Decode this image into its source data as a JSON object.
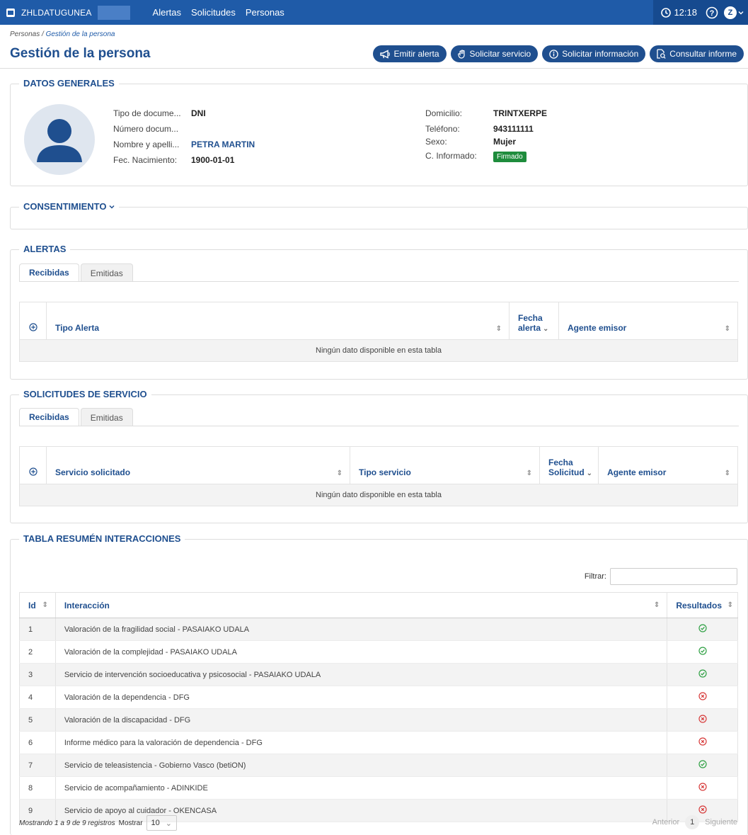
{
  "topbar": {
    "brand": "ZHLDATUGUNEA",
    "nav": [
      "Alertas",
      "Solicitudes",
      "Personas"
    ],
    "time": "12:18",
    "user_initial": "Z"
  },
  "breadcrumb": {
    "parent": "Personas",
    "separator": " / ",
    "current": "Gestión de la persona"
  },
  "page_title": "Gestión de la persona",
  "actions": {
    "emitir": "Emitir alerta",
    "solicitar_servicio": "Solicitar servicio",
    "solicitar_informacion": "Solicitar información",
    "consultar_informe": "Consultar informe"
  },
  "datos_generales": {
    "title": "DATOS GENERALES",
    "left": [
      {
        "label": "Tipo de docume...",
        "value": "DNI"
      },
      {
        "label": "Número docum...",
        "value": ""
      },
      {
        "label": "Nombre y apelli...",
        "value": "PETRA MARTIN"
      },
      {
        "label": "Fec. Nacimiento:",
        "value": "1900-01-01"
      }
    ],
    "right": [
      {
        "label": "Domicilio:",
        "value": "TRINTXERPE"
      },
      {
        "label": "Teléfono:",
        "value": "943111111"
      },
      {
        "label": "Sexo:",
        "value": "Mujer"
      },
      {
        "label": "C. Informado:",
        "value": "Firmado"
      }
    ]
  },
  "consentimiento": {
    "title": "CONSENTIMIENTO"
  },
  "alertas": {
    "title": "ALERTAS",
    "tabs": [
      "Recibidas",
      "Emitidas"
    ],
    "columns": [
      "Tipo Alerta",
      "Fecha",
      "alerta",
      "Agente emisor"
    ],
    "empty": "Ningún dato disponible en esta tabla"
  },
  "solicitudes": {
    "title": "SOLICITUDES DE SERVICIO",
    "tabs": [
      "Recibidas",
      "Emitidas"
    ],
    "columns": [
      "Servicio solicitado",
      "Tipo servicio",
      "Fecha",
      "Solicitud",
      "Agente emisor"
    ],
    "empty": "Ningún dato disponible en esta tabla"
  },
  "resumen": {
    "title": "TABLA RESUMÉN INTERACCIONES",
    "filter_label": "Filtrar:",
    "filter_value": "",
    "columns": [
      "Id",
      "Interacción",
      "Resultados"
    ],
    "rows": [
      {
        "id": "1",
        "interaccion": "Valoración de la fragilidad social - PASAIAKO UDALA",
        "ok": true
      },
      {
        "id": "2",
        "interaccion": "Valoración de la complejidad - PASAIAKO UDALA",
        "ok": true
      },
      {
        "id": "3",
        "interaccion": "Servicio de intervención socioeducativa y psicosocial - PASAIAKO UDALA",
        "ok": true
      },
      {
        "id": "4",
        "interaccion": "Valoración de la dependencia - DFG",
        "ok": false
      },
      {
        "id": "5",
        "interaccion": "Valoración de la discapacidad - DFG",
        "ok": false
      },
      {
        "id": "6",
        "interaccion": "Informe médico para la valoración de dependencia - DFG",
        "ok": false
      },
      {
        "id": "7",
        "interaccion": "Servicio de teleasistencia - Gobierno Vasco (betiON)",
        "ok": true
      },
      {
        "id": "8",
        "interaccion": "Servicio de acompañamiento - ADINKIDE",
        "ok": false
      },
      {
        "id": "9",
        "interaccion": "Servicio de apoyo al cuidador - OKENCASA",
        "ok": false
      }
    ],
    "footer": {
      "info": "Mostrando 1 a 9 de 9 registros",
      "show_label": "Mostrar",
      "page_size": "10",
      "prev": "Anterior",
      "page": "1",
      "next": "Siguiente"
    }
  },
  "colors": {
    "primary": "#1f4f8f",
    "topbar": "#1f5ba8",
    "ok": "#2ea043",
    "ko": "#d73a3a",
    "badge": "#1e8c3c"
  }
}
